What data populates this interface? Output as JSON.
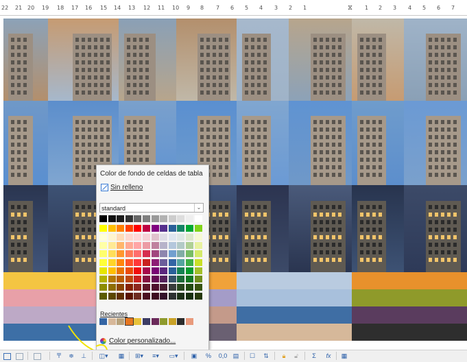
{
  "ruler": {
    "labels": [
      "22",
      "21",
      "20",
      "19",
      "18",
      "17",
      "16",
      "15",
      "14",
      "13",
      "12",
      "11",
      "10",
      "9",
      "8",
      "7",
      "6",
      "5",
      "4",
      "3",
      "2",
      "1",
      "1",
      "2",
      "3",
      "4",
      "5",
      "6",
      "7"
    ]
  },
  "popup": {
    "title": "Color de fondo de celdas de tabla",
    "no_fill": "Sin relleno",
    "palette_name": "standard",
    "recent_label": "Recientes",
    "custom_color": "Color personalizado...",
    "rows": [
      [
        "#000000",
        "#111111",
        "#1c1c1c",
        "#333333",
        "#666666",
        "#808080",
        "#999999",
        "#b2b2b2",
        "#cccccc",
        "#dddddd",
        "#eeeeee",
        "#ffffff"
      ],
      [
        "#ffff00",
        "#ffbf00",
        "#ff8000",
        "#ff4000",
        "#ff0000",
        "#bf0041",
        "#800080",
        "#55308d",
        "#2a6099",
        "#158466",
        "#00a933",
        "#81d41a"
      ],
      [
        "#ffffd7",
        "#fff5ce",
        "#ffdbb6",
        "#ffd8ce",
        "#ffd7d7",
        "#f7d1d5",
        "#e0c2cd",
        "#dedce6",
        "#dee6ef",
        "#dee7e5",
        "#dde8cb",
        "#f6f9d4"
      ],
      [
        "#ffffa6",
        "#ffe994",
        "#ffb66c",
        "#ffaa95",
        "#ffa6a6",
        "#ec9ba4",
        "#bf819e",
        "#b7b3ca",
        "#b4c7dc",
        "#b3cac7",
        "#afd095",
        "#e8f2a1"
      ],
      [
        "#ffff6d",
        "#ffde59",
        "#ff972f",
        "#ff7b59",
        "#ff6d6d",
        "#d62e4e",
        "#a1467e",
        "#8e86ae",
        "#729fcf",
        "#81aca6",
        "#77bc65",
        "#d4ea6b"
      ],
      [
        "#ffff38",
        "#ffd428",
        "#ff860d",
        "#ff5429",
        "#ff3838",
        "#c9211e",
        "#8d1d75",
        "#6b5e9b",
        "#3465a4",
        "#55a49f",
        "#3faf46",
        "#c9e028"
      ],
      [
        "#e6e600",
        "#ffbf00",
        "#ea7500",
        "#ed4c05",
        "#f10d0c",
        "#a7074b",
        "#780373",
        "#5b277d",
        "#2a6099",
        "#168253",
        "#069a2e",
        "#a3c02a"
      ],
      [
        "#b2b200",
        "#b47804",
        "#b85c00",
        "#be480a",
        "#c9211e",
        "#861141",
        "#650953",
        "#55215b",
        "#355269",
        "#1e6a39",
        "#127622",
        "#708e1d"
      ],
      [
        "#8d8d00",
        "#8e6d02",
        "#8c4500",
        "#872202",
        "#8d281e",
        "#611729",
        "#4e102d",
        "#481d32",
        "#383d3c",
        "#28471f",
        "#224b12",
        "#395511"
      ],
      [
        "#5b5b00",
        "#5b4700",
        "#603000",
        "#5a1400",
        "#6d2a20",
        "#4b1020",
        "#3c0c20",
        "#33122a",
        "#2c2f30",
        "#1b2f16",
        "#162f0d",
        "#263a0b"
      ]
    ],
    "recent": [
      "#3465a4",
      "#d7b899",
      "#b8a27c",
      "#e6761f",
      "#e8c23a",
      "#3c3c64",
      "#6b2a5a",
      "#8e9a2c",
      "#c9a227",
      "#2c2c2c",
      "#e89a7c"
    ]
  },
  "toolbar": {
    "sum_label": "Σ",
    "fx_label": "fx",
    "percent_label": "%",
    "decimal_label": "0,0"
  }
}
